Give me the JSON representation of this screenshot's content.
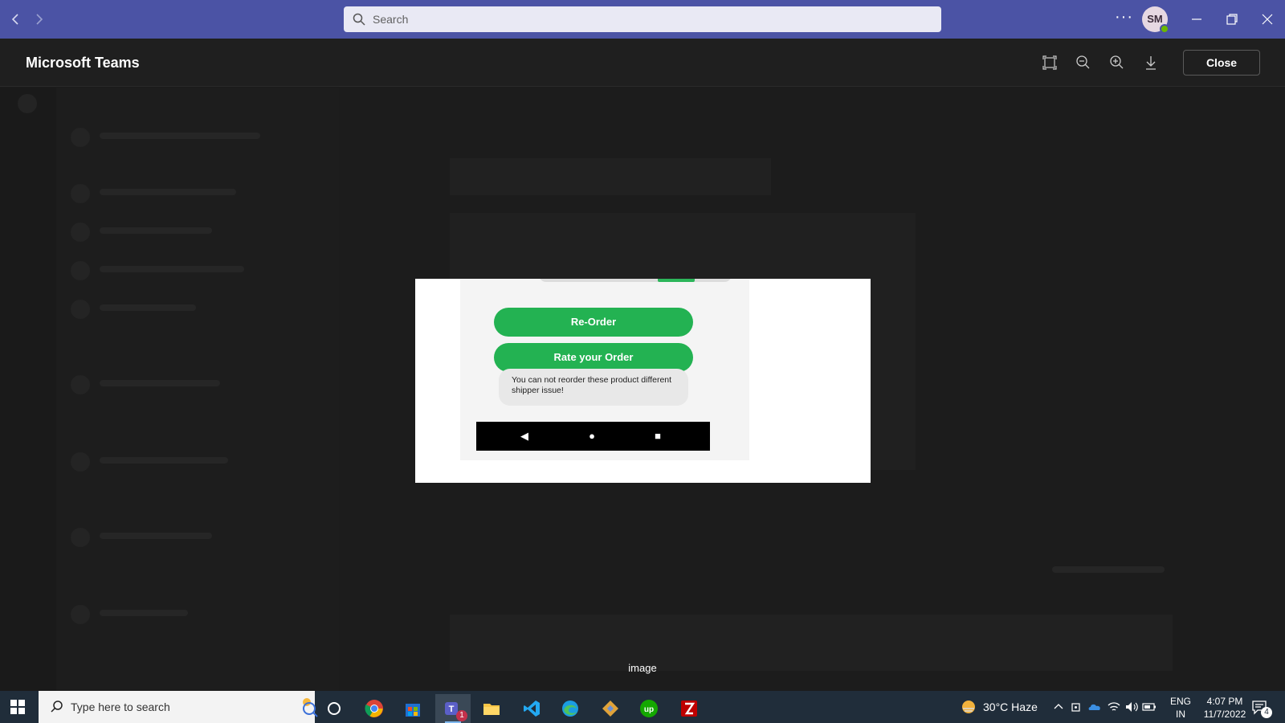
{
  "titlebar": {
    "back_icon": "chevron-left-icon",
    "forward_icon": "chevron-right-icon",
    "search_placeholder": "Search",
    "more_label": "···",
    "avatar_initials": "SM",
    "brand_color": "#4b53a5"
  },
  "viewer": {
    "title": "Microsoft Teams",
    "close_label": "Close",
    "tools": [
      "fit-screen-icon",
      "zoom-out-icon",
      "zoom-in-icon",
      "download-icon"
    ]
  },
  "preview": {
    "reorder_label": "Re-Order",
    "rate_label": "Rate your Order",
    "toast_text": "You can not reorder these product different shipper issue!",
    "button_color": "#23b252",
    "caption": "image"
  },
  "taskbar": {
    "search_placeholder": "Type here to search",
    "weather": "30°C  Haze",
    "lang_top": "ENG",
    "lang_bottom": "IN",
    "time": "4:07 PM",
    "date": "11/7/2022",
    "teams_badge": "1",
    "notif_count": "4"
  }
}
